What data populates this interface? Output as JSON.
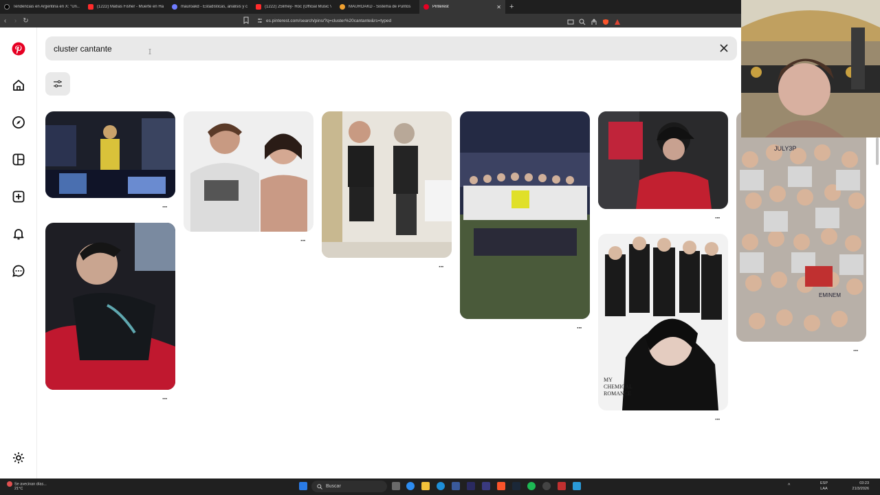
{
  "browser": {
    "tabs": [
      {
        "title": "Tendencias en Argentina en X: \"Un...",
        "color": "#ffffff"
      },
      {
        "title": "(1222) Matías Fisher - Muerte en Ha...",
        "color": "#ff2b2b"
      },
      {
        "title": "mauroakd - Estadísticas, análisis y c...",
        "color": "#6f7cff"
      },
      {
        "title": "(1222) 25limey- Roc (Official Music V...",
        "color": "#ff2b2b"
      },
      {
        "title": "MAUROAKD - Sistema de Puntos",
        "color": "#f0a030"
      },
      {
        "title": "Pinterest",
        "color": "#e60023"
      }
    ],
    "url": "es.pinterest.com/search/pins/?q=cluster%20cantante&rs=typed"
  },
  "search": {
    "query": "cluster cantante"
  },
  "sidebar": {
    "items": [
      "pinterest-logo",
      "home-icon",
      "explore-icon",
      "boards-icon",
      "create-icon",
      "notifications-icon",
      "messages-icon",
      "settings-icon"
    ]
  },
  "pins": {
    "more_label": "···",
    "poster_text": [
      "MY",
      "CHEMICAL",
      "ROMANCE"
    ],
    "collage_text": [
      "JULY3P",
      "EMINEM"
    ]
  },
  "taskbar": {
    "weather": [
      "Se avecinan días...",
      "21°C"
    ],
    "search_placeholder": "Buscar",
    "lang": [
      "ESP",
      "LAA"
    ],
    "time": "03:23",
    "date": "21/3/2026"
  },
  "colors": {
    "pinterest_red": "#e60023",
    "search_bg": "#e9e9e9",
    "chrome_dark": "#1f1f1f"
  }
}
